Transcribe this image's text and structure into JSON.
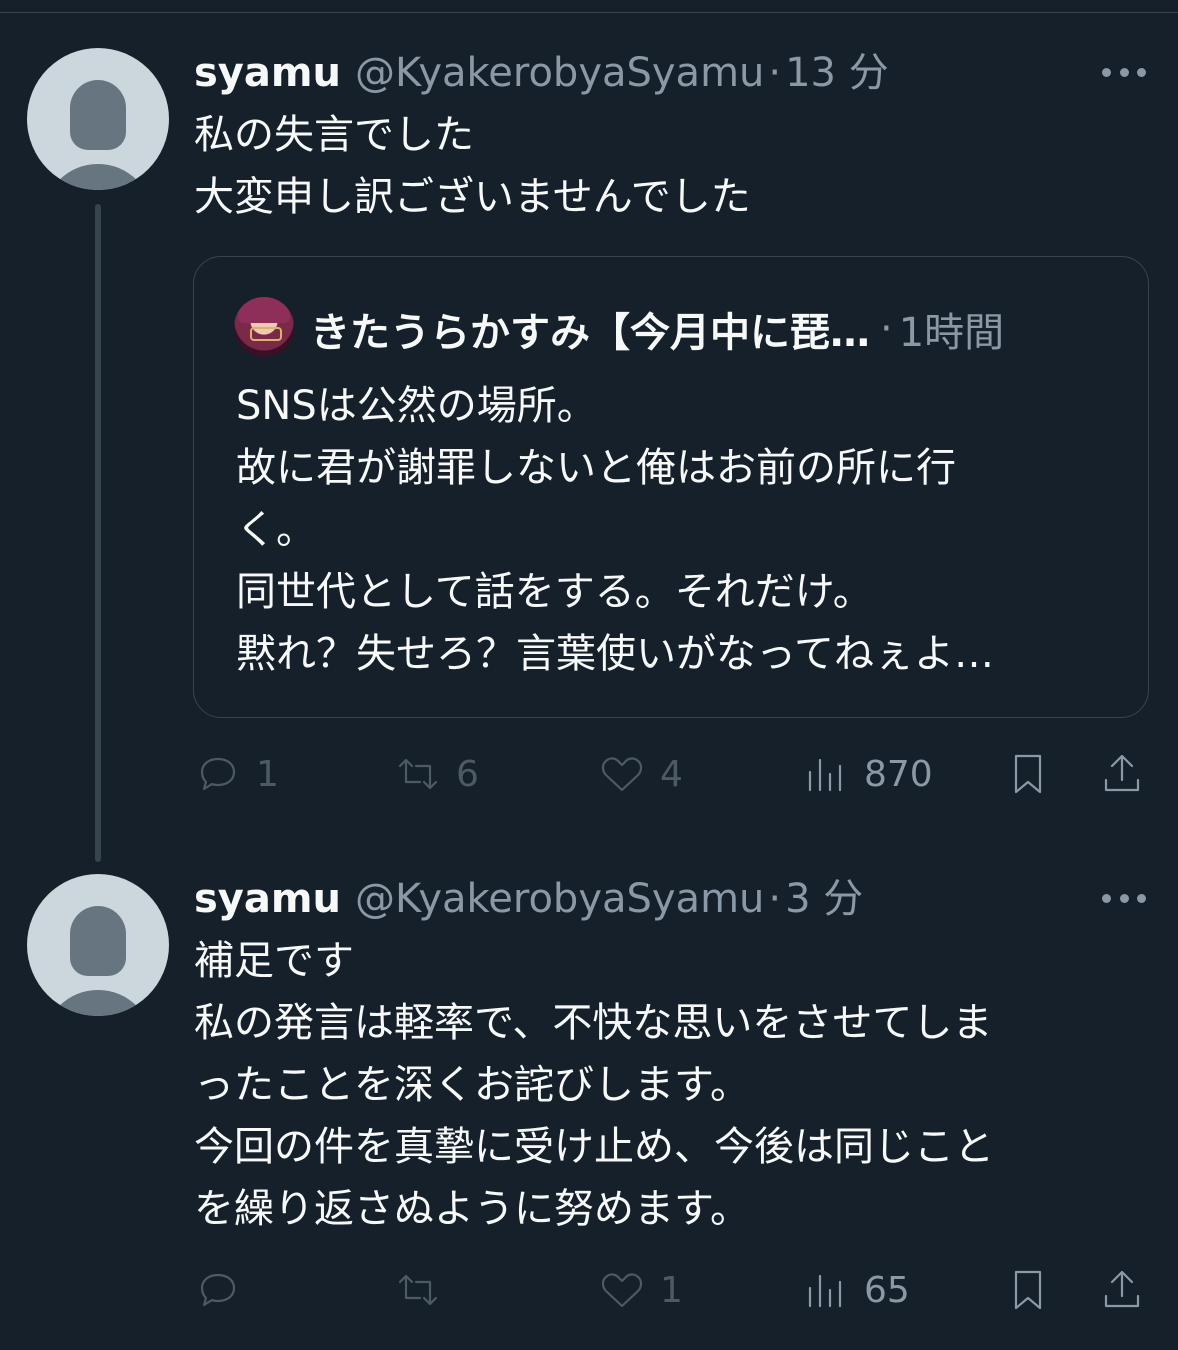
{
  "tweets": [
    {
      "display_name": "syamu",
      "handle": "@KyakerobyaSyamu",
      "separator": "·",
      "time": "13 分",
      "text": "私の失言でした\n大変申し訳ございませんでした",
      "quote": {
        "display_name": "きたうらかすみ【今月中に琵…",
        "separator": "·",
        "time": "1時間",
        "text": "SNSは公然の場所。\n故に君が謝罪しないと俺はお前の所に行\nく。\n同世代として話をする。それだけ。\n黙れ？失せろ？言葉使いがなってねぇよ…"
      },
      "actions": {
        "replies": "1",
        "retweets": "6",
        "likes": "4",
        "views": "870"
      }
    },
    {
      "display_name": "syamu",
      "handle": "@KyakerobyaSyamu",
      "separator": "·",
      "time": "3 分",
      "text": "補足です\n私の発言は軽率で、不快な思いをさせてしま\nったことを深くお詫びします。\n今回の件を真摯に受け止め、今後は同じこと\nを繰り返さぬように努めます。",
      "actions": {
        "replies": "",
        "retweets": "",
        "likes": "1",
        "views": "65"
      }
    }
  ],
  "icons": {
    "reply": "speech-bubble",
    "retweet": "retweet-arrows",
    "like": "heart",
    "views": "bar-chart",
    "bookmark": "bookmark",
    "share": "share-upload"
  },
  "colors": {
    "background": "#15202b",
    "text": "#f7f9f9",
    "secondary": "#8b98a5",
    "border": "#38444d"
  }
}
